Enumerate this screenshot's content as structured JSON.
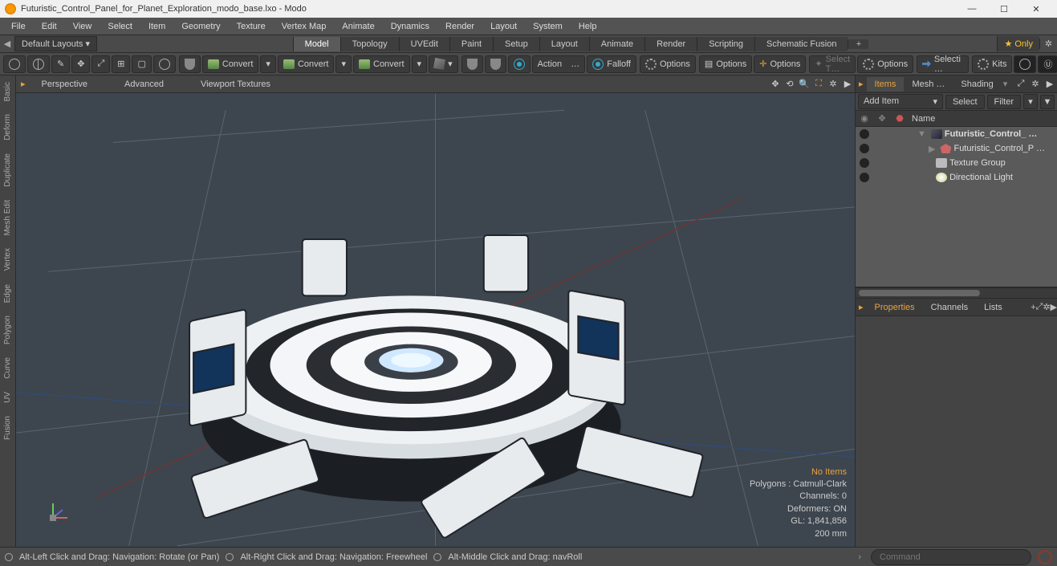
{
  "title": "Futuristic_Control_Panel_for_Planet_Exploration_modo_base.lxo - Modo",
  "menus": [
    "File",
    "Edit",
    "View",
    "Select",
    "Item",
    "Geometry",
    "Texture",
    "Vertex Map",
    "Animate",
    "Dynamics",
    "Render",
    "Layout",
    "System",
    "Help"
  ],
  "layoutPreset": "Default Layouts",
  "layoutTabs": [
    "Model",
    "Topology",
    "UVEdit",
    "Paint",
    "Setup",
    "Layout",
    "Animate",
    "Render",
    "Scripting",
    "Schematic Fusion"
  ],
  "layoutActive": "Model",
  "onlyLabel": "Only",
  "toolbar": {
    "convert": "Convert",
    "action": "Action",
    "ellipsis": "…",
    "falloff": "Falloff",
    "options": "Options",
    "selectT": "Select T…",
    "selecti": "Selecti …",
    "kits": "Kits"
  },
  "leftTabs": [
    "Basic",
    "Deform",
    "Duplicate",
    "Mesh Edit",
    "Vertex",
    "Edge",
    "Polygon",
    "Curve",
    "UV",
    "Fusion"
  ],
  "viewportTabs": [
    "Perspective",
    "Advanced",
    "Viewport Textures"
  ],
  "stats": {
    "noItems": "No Items",
    "polys": "Polygons : Catmull-Clark",
    "channels": "Channels: 0",
    "deformers": "Deformers: ON",
    "gl": "GL: 1,841,856",
    "scale": "200 mm"
  },
  "itemsTabs": [
    "Items",
    "Mesh …",
    "Shading"
  ],
  "itemsToolbar": {
    "addItem": "Add Item",
    "select": "Select",
    "filter": "Filter"
  },
  "itemsHeader": {
    "name": "Name"
  },
  "items": [
    {
      "depth": 0,
      "icon": "scene",
      "label": "Futuristic_Control_ …",
      "bold": true,
      "arrow": "▼"
    },
    {
      "depth": 1,
      "icon": "mesh",
      "label": "Futuristic_Control_P …",
      "arrow": "▶"
    },
    {
      "depth": 1,
      "icon": "folder",
      "label": "Texture Group"
    },
    {
      "depth": 1,
      "icon": "light",
      "label": "Directional Light"
    }
  ],
  "propsTabs": [
    "Properties",
    "Channels",
    "Lists"
  ],
  "statusHints": [
    "Alt-Left Click and Drag: Navigation: Rotate (or Pan)",
    "Alt-Right Click and Drag: Navigation: Freewheel",
    "Alt-Middle Click and Drag: navRoll"
  ],
  "commandPlaceholder": "Command"
}
